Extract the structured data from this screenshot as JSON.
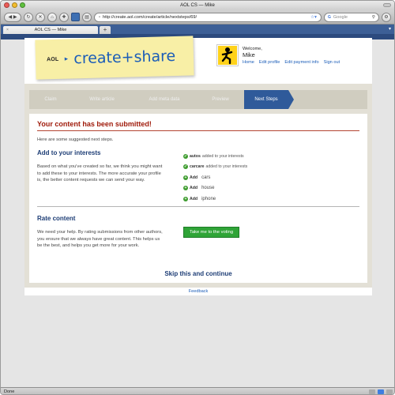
{
  "browser": {
    "window_title": "AOL CS — Mike",
    "url": "http://create.aol.com/create/article/nextsteps/69/",
    "search_placeholder": "Google",
    "search_engine_badge": "G",
    "tab_label": "AOL CS — Mike",
    "tab_close": "×",
    "new_tab": "+",
    "status_text": "Done"
  },
  "site": {
    "brand_small": "AOL",
    "brand_arrow": "►",
    "brand_main": "create+share",
    "welcome": "Welcome,",
    "username": "Mike",
    "user_links": [
      "Home",
      "Edit profile",
      "Edit payment info",
      "Sign out"
    ]
  },
  "steps": {
    "items": [
      "Claim",
      "Write article",
      "Add meta data",
      "Preview",
      "Next Steps"
    ],
    "active_index": 4
  },
  "content": {
    "title": "Your content has been submitted!",
    "intro": "Here are some suggested next steps.",
    "interests": {
      "heading": "Add to your interests",
      "body": "Based on what you've created so far, we think you might want to add these to your interests. The more accurate your profile is, the better content requests we can send your way.",
      "added": [
        {
          "name": "autos",
          "suffix": "added to your interests"
        },
        {
          "name": "carcare",
          "suffix": "added to your interests"
        }
      ],
      "add_label": "Add",
      "suggestions": [
        "cars",
        "house",
        "iphone"
      ]
    },
    "rate": {
      "heading": "Rate content",
      "body": "We need your help. By rating submissions from other authors, you ensure that we always have great content. This helps us be the best, and helps you get more for your work.",
      "button": "Take me to the voting"
    },
    "skip": "Skip this and continue"
  },
  "footer": {
    "link": "Feedback"
  },
  "colors": {
    "accent": "#1b5db8",
    "title_red": "#a01c0c",
    "button_green": "#2fa437",
    "active_step": "#2f5a9a"
  }
}
